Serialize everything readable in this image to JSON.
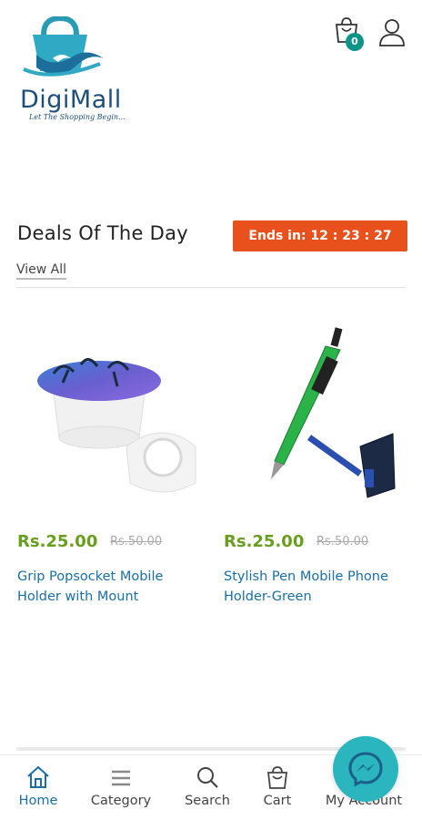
{
  "brand": {
    "name": "DigiMall",
    "tagline": "Let The Shopping Begin..."
  },
  "header": {
    "cart_count": "0"
  },
  "deals": {
    "title": "Deals Of The Day",
    "timer": "Ends in: 12 : 23 : 27",
    "view_all": "View All"
  },
  "products": [
    {
      "price": "Rs.25.00",
      "old_price": "Rs.50.00",
      "name": "Grip Popsocket Mobile Holder with Mount"
    },
    {
      "price": "Rs.25.00",
      "old_price": "Rs.50.00",
      "name": "Stylish Pen Mobile Phone Holder-Green"
    }
  ],
  "bottom_nav": [
    {
      "label": "Home",
      "icon": "home-icon",
      "active": true
    },
    {
      "label": "Category",
      "icon": "menu-icon",
      "active": false
    },
    {
      "label": "Search",
      "icon": "search-icon",
      "active": false
    },
    {
      "label": "Cart",
      "icon": "cart-icon",
      "active": false
    },
    {
      "label": "My Account",
      "icon": "user-icon",
      "active": false
    }
  ],
  "colors": {
    "accent_blue": "#1a6fa8",
    "price_green": "#6a9e1f",
    "timer_orange": "#e8501c",
    "badge_teal": "#0d9488",
    "messenger_teal": "#2bb5bf"
  }
}
